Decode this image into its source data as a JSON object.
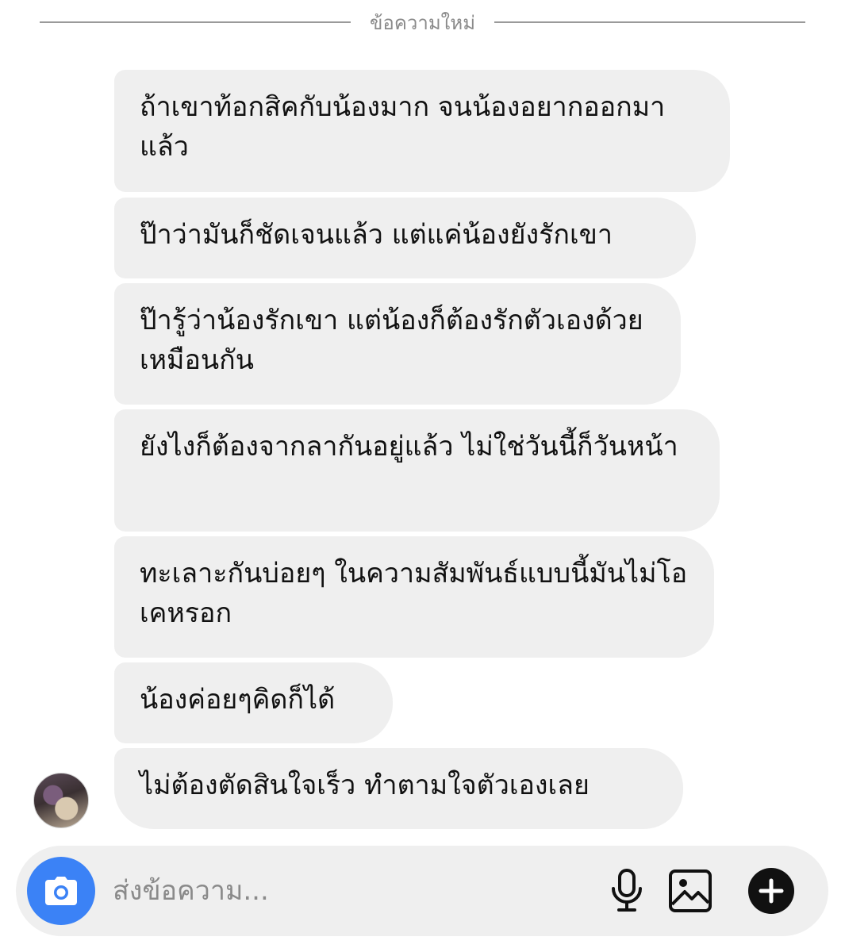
{
  "header": {
    "divider_label": "ข้อความใหม่"
  },
  "messages": [
    {
      "text": "ถ้าเขาท้อกสิคกับน้องมาก จนน้องอยากออกมาแล้ว"
    },
    {
      "text": "ป๊าว่ามันก็ชัดเจนแล้ว แต่แค่น้องยังรักเขา"
    },
    {
      "text": "ป๊ารู้ว่าน้องรักเขา แต่น้องก็ต้องรักตัวเองด้วยเหมือนกัน"
    },
    {
      "text": "ยังไงก็ต้องจากลากันอยู่แล้ว ไม่ใช่วันนี้ก็วันหน้า"
    },
    {
      "text": "ทะเลาะกันบ่อยๆ ในความสัมพันธ์แบบนี้มันไม่โอเคหรอก"
    },
    {
      "text": "น้องค่อยๆคิดก็ได้"
    },
    {
      "text": "ไม่ต้องตัดสินใจเร็ว ทำตามใจตัวเองเลย"
    }
  ],
  "sender": {
    "avatar_icon": "profile-photo"
  },
  "composer": {
    "placeholder": "ส่งข้อความ...",
    "camera_icon": "camera-icon",
    "mic_icon": "microphone-icon",
    "gallery_icon": "image-icon",
    "add_icon": "plus-circle-icon",
    "accent_color": "#3b82f6"
  }
}
